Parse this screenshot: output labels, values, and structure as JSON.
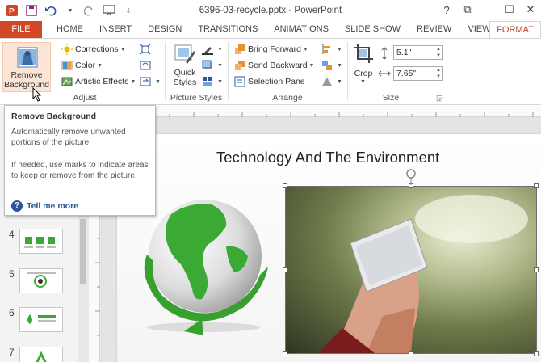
{
  "window": {
    "title": "6396-03-recycle.pptx - PowerPoint",
    "controls": [
      "?",
      "⧉",
      "—",
      "☐",
      "✕"
    ]
  },
  "tabs": [
    "FILE",
    "HOME",
    "INSERT",
    "DESIGN",
    "TRANSITIONS",
    "ANIMATIONS",
    "SLIDE SHOW",
    "REVIEW",
    "VIEW",
    "FORMAT"
  ],
  "ribbon": {
    "remove_bg_label": "Remove Background",
    "corrections": "Corrections",
    "color": "Color",
    "artistic": "Artistic Effects",
    "adjust_group": "Adjust",
    "quick_styles": "Quick Styles",
    "picture_styles_group": "Picture Styles",
    "bring_forward": "Bring Forward",
    "send_backward": "Send Backward",
    "selection_pane": "Selection Pane",
    "arrange_group": "Arrange",
    "crop": "Crop",
    "height": "5.1\"",
    "width": "7.65\"",
    "size_group": "Size"
  },
  "tooltip": {
    "title": "Remove Background",
    "p1": "Automatically remove unwanted portions of the picture.",
    "p2": "If needed, use marks to indicate areas to keep or remove from the picture.",
    "more": "Tell me more"
  },
  "thumbnails": [
    "4",
    "5",
    "6",
    "7"
  ],
  "slide": {
    "title": "Technology And The Environment"
  },
  "colors": {
    "file_tab": "#d24726",
    "format_tab_text": "#b7472a",
    "globe_green": "#3aaa35",
    "link_blue": "#2b579a"
  }
}
